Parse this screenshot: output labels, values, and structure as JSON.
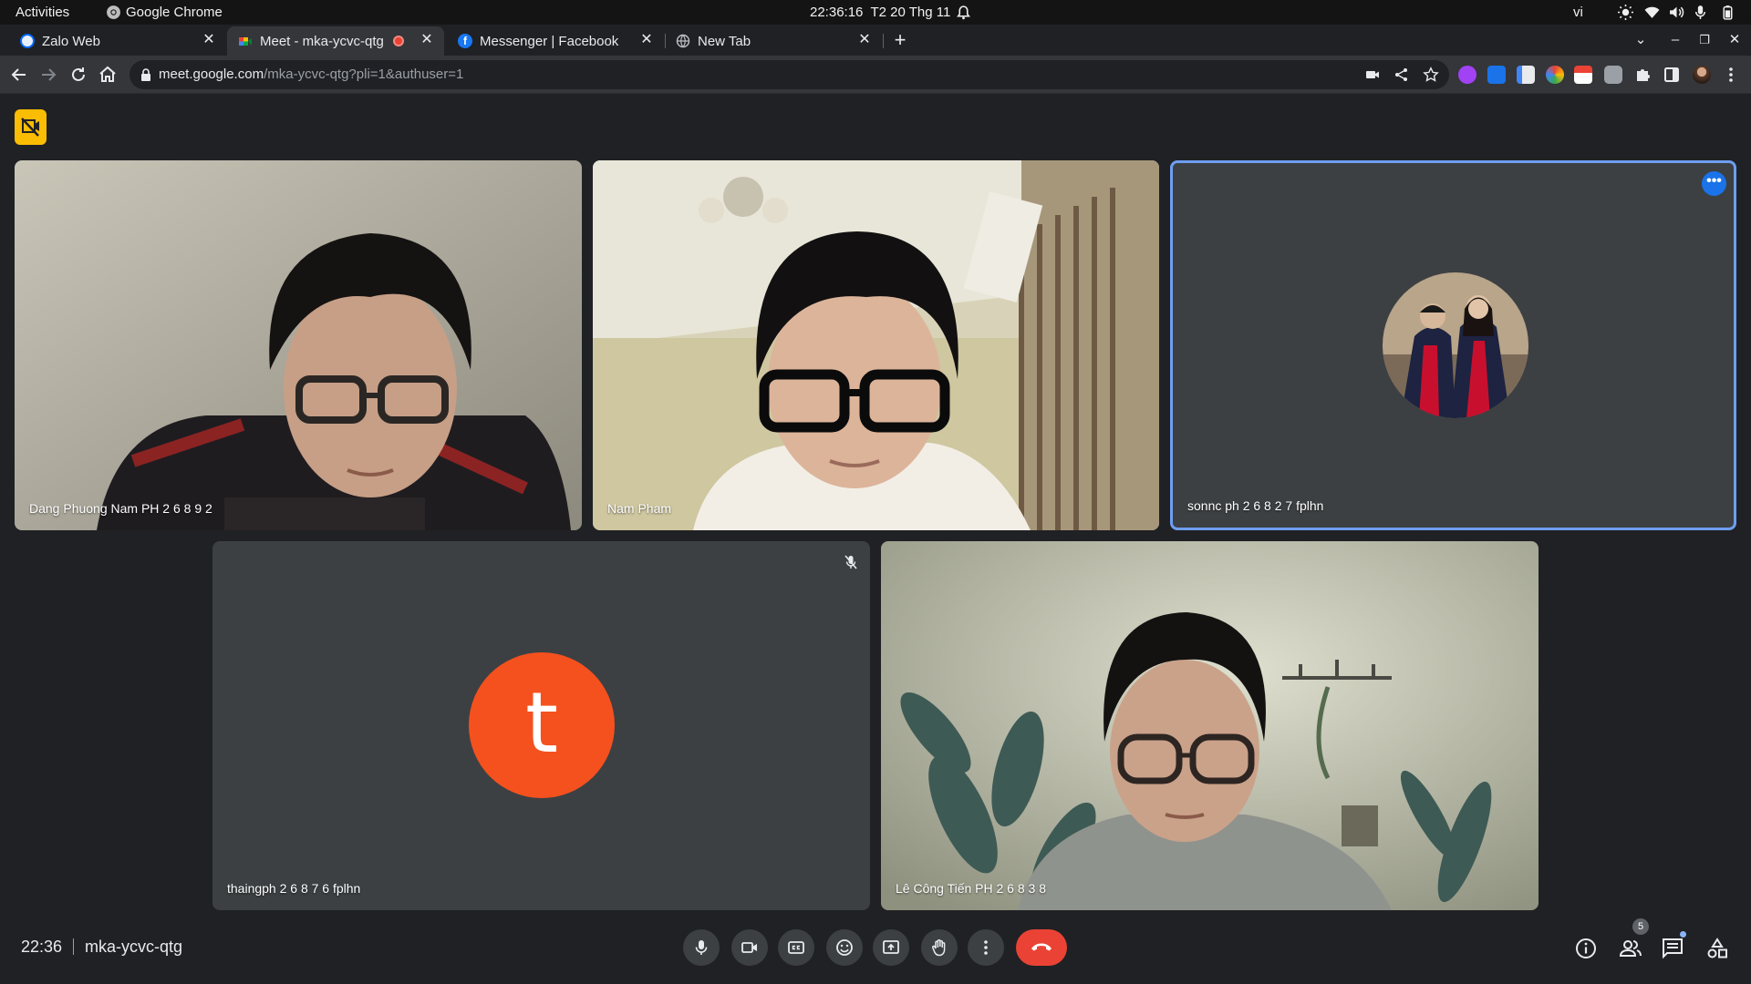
{
  "system_bar": {
    "activities": "Activities",
    "app_name": "Google Chrome",
    "clock": "22:36:16  T2 20 Thg 11",
    "input_language": "vi"
  },
  "tabs": [
    {
      "title": "Zalo Web",
      "icon": "zalo-icon"
    },
    {
      "title": "Meet - mka-ycvc-qtg",
      "icon": "meet-icon",
      "active": true,
      "recording_indicator": true
    },
    {
      "title": "Messenger | Facebook",
      "icon": "facebook-icon"
    },
    {
      "title": "New Tab",
      "icon": "globe-icon"
    }
  ],
  "address_bar": {
    "host": "meet.google.com",
    "path": "/mka-ycvc-qtg?pli=1&authuser=1"
  },
  "participants": [
    {
      "name": "Dang Phuong Nam PH 2 6 8 9 2",
      "video": true
    },
    {
      "name": "Nam Pham",
      "video": true
    },
    {
      "name": "sonnc ph 2 6 8 2 7 fplhn",
      "video": false,
      "avatar": "photo",
      "highlighted": true
    },
    {
      "name": "thaingph 2 6 8 7 6 fplhn",
      "video": false,
      "avatar_letter": "t",
      "muted": true
    },
    {
      "name": "Lê Công Tiến PH 2 6 8 3 8",
      "video": true
    }
  ],
  "footer": {
    "time": "22:36",
    "meeting_code": "mka-ycvc-qtg",
    "people_count": "5",
    "more_options_glyph": "•••"
  },
  "controls": [
    "mic-icon",
    "camera-icon",
    "captions-icon",
    "emoji-icon",
    "present-icon",
    "raise-hand-icon",
    "more-vert-icon",
    "hangup-icon"
  ],
  "colors": {
    "background": "#202124",
    "tile": "#3c4043",
    "highlight_border": "#6e9ef0",
    "hangup": "#ea4335",
    "avatar_letter_bg": "#f4511e",
    "selfview_toggle": "#fbbc04"
  }
}
